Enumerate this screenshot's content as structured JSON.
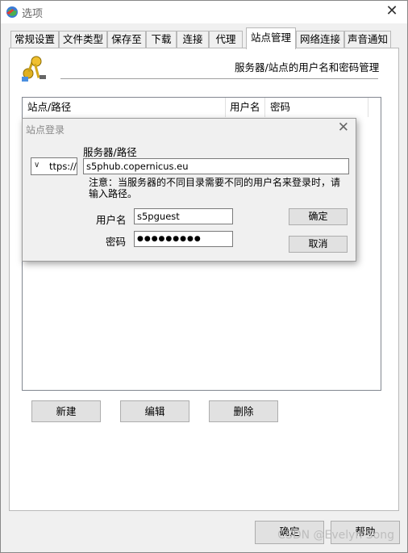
{
  "window": {
    "title": "选项"
  },
  "tabs": [
    {
      "label": "常规设置",
      "active": false
    },
    {
      "label": "文件类型",
      "active": false
    },
    {
      "label": "保存至",
      "active": false
    },
    {
      "label": "下载",
      "active": false
    },
    {
      "label": "连接",
      "active": false
    },
    {
      "label": "代理",
      "active": false
    },
    {
      "label": "站点管理",
      "active": true
    },
    {
      "label": "网络连接",
      "active": false
    },
    {
      "label": "声音通知",
      "active": false
    }
  ],
  "section": {
    "title": "服务器/站点的用户名和密码管理"
  },
  "list": {
    "columns": [
      "站点/路径",
      "用户名",
      "密码"
    ]
  },
  "actions": {
    "new": "新建",
    "edit": "编辑",
    "delete": "删除"
  },
  "footer": {
    "ok": "确定",
    "help": "帮助"
  },
  "dialog": {
    "title": "站点登录",
    "protocol": "ttps://",
    "server_label": "服务器/路径",
    "server_value": "s5phub.copernicus.eu",
    "note": "注意：当服务器的不同目录需要不同的用户名来登录时，请输入路径。",
    "username_label": "用户名",
    "username_value": "s5pguest",
    "password_label": "密码",
    "password_value": "●●●●●●●●●",
    "ok": "确定",
    "cancel": "取消"
  },
  "watermark": "CSDN @Evelyn Song"
}
